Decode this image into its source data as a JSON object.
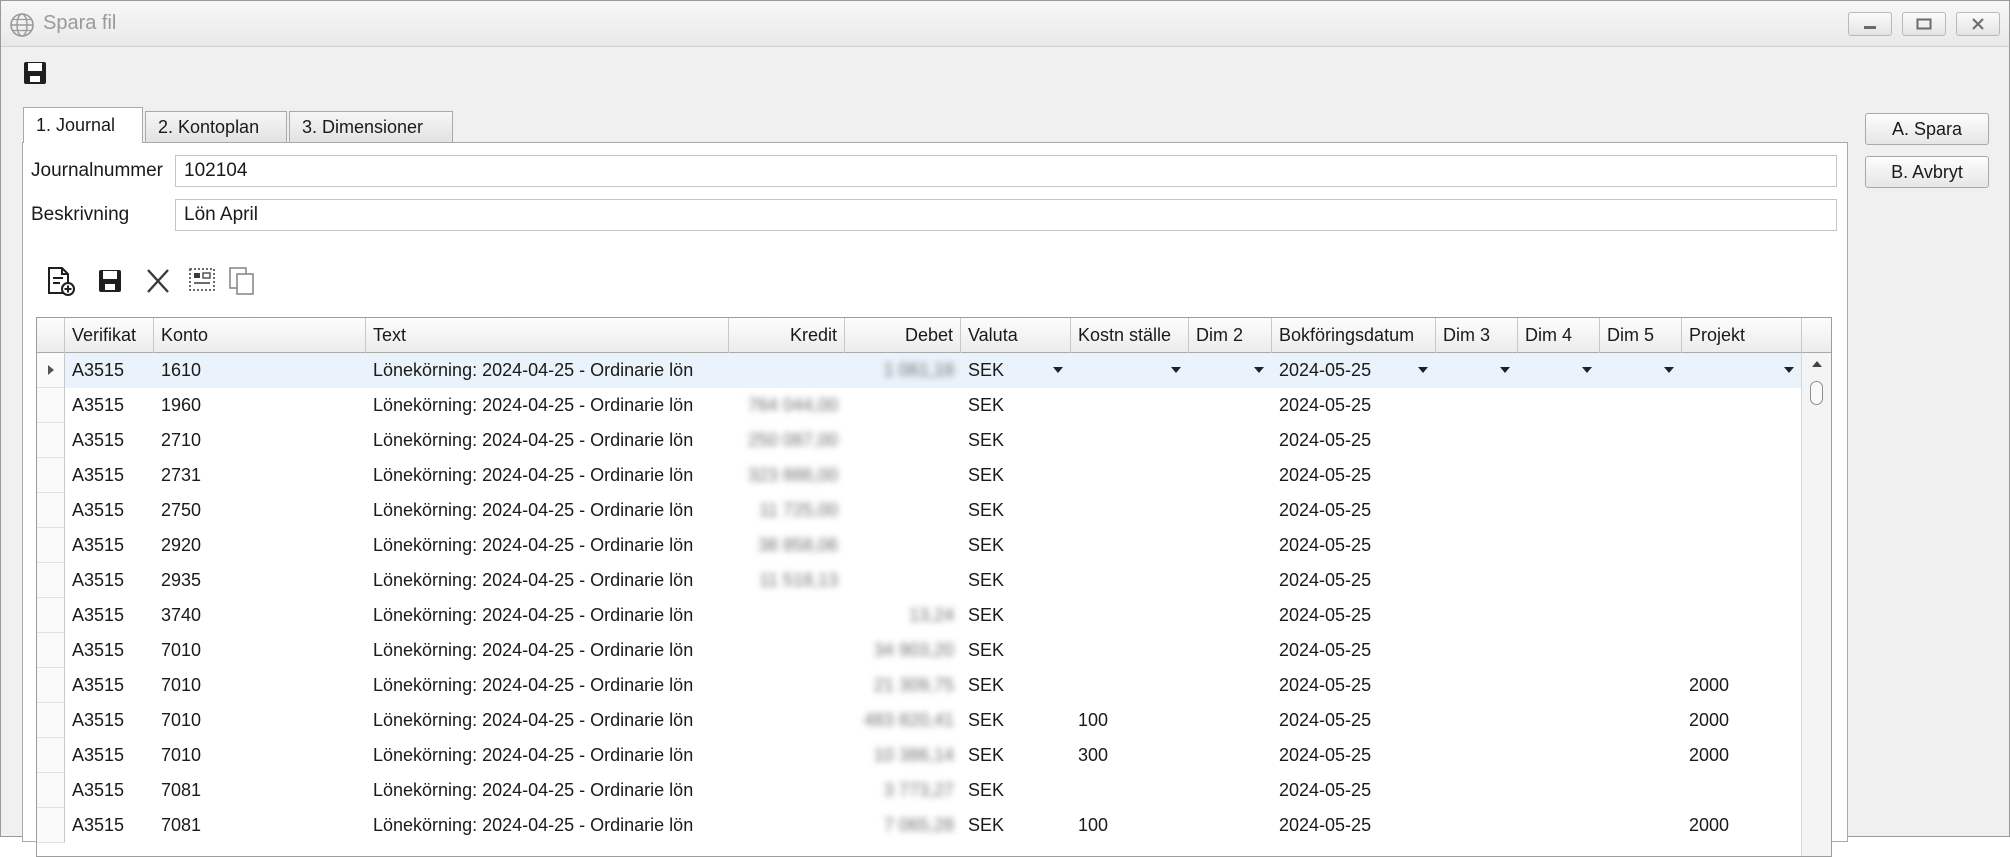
{
  "window": {
    "title": "Spara fil",
    "icon": "globe-icon",
    "controls": [
      "minimize-icon",
      "maximize-icon",
      "close-icon"
    ]
  },
  "toolbar": {
    "save_icon": "floppy-disk-icon"
  },
  "tabs": [
    {
      "label": "1. Journal",
      "active": true
    },
    {
      "label": "2. Kontoplan",
      "active": false
    },
    {
      "label": "3. Dimensioner",
      "active": false
    }
  ],
  "form": {
    "journalnummer_label": "Journalnummer",
    "journalnummer_value": "102104",
    "beskrivning_label": "Beskrivning",
    "beskrivning_value": "Lön April"
  },
  "grid_toolbar": [
    "new-document-icon",
    "save-icon",
    "delete-icon",
    "select-columns-icon",
    "copy-icon"
  ],
  "grid": {
    "columns": [
      "Verifikat",
      "Konto",
      "Text",
      "Kredit",
      "Debet",
      "Valuta",
      "Kostn ställe",
      "Dim 2",
      "Bokföringsdatum",
      "Dim 3",
      "Dim 4",
      "Dim 5",
      "Projekt"
    ],
    "rows": [
      {
        "verifikat": "A3515",
        "konto": "1610",
        "text": "Lönekörning: 2024-04-25 - Ordinarie lön",
        "kredit": "",
        "debet": "1 061,18",
        "valuta": "SEK",
        "kostnstalle": "",
        "dim2": "",
        "datum": "2024-05-25",
        "dim3": "",
        "dim4": "",
        "dim5": "",
        "projekt": ""
      },
      {
        "verifikat": "A3515",
        "konto": "1960",
        "text": "Lönekörning: 2024-04-25 - Ordinarie lön",
        "kredit": "764 044,00",
        "debet": "",
        "valuta": "SEK",
        "kostnstalle": "",
        "dim2": "",
        "datum": "2024-05-25",
        "dim3": "",
        "dim4": "",
        "dim5": "",
        "projekt": ""
      },
      {
        "verifikat": "A3515",
        "konto": "2710",
        "text": "Lönekörning: 2024-04-25 - Ordinarie lön",
        "kredit": "250 087,00",
        "debet": "",
        "valuta": "SEK",
        "kostnstalle": "",
        "dim2": "",
        "datum": "2024-05-25",
        "dim3": "",
        "dim4": "",
        "dim5": "",
        "projekt": ""
      },
      {
        "verifikat": "A3515",
        "konto": "2731",
        "text": "Lönekörning: 2024-04-25 - Ordinarie lön",
        "kredit": "323 886,00",
        "debet": "",
        "valuta": "SEK",
        "kostnstalle": "",
        "dim2": "",
        "datum": "2024-05-25",
        "dim3": "",
        "dim4": "",
        "dim5": "",
        "projekt": ""
      },
      {
        "verifikat": "A3515",
        "konto": "2750",
        "text": "Lönekörning: 2024-04-25 - Ordinarie lön",
        "kredit": "11 725,00",
        "debet": "",
        "valuta": "SEK",
        "kostnstalle": "",
        "dim2": "",
        "datum": "2024-05-25",
        "dim3": "",
        "dim4": "",
        "dim5": "",
        "projekt": ""
      },
      {
        "verifikat": "A3515",
        "konto": "2920",
        "text": "Lönekörning: 2024-04-25 - Ordinarie lön",
        "kredit": "38 858,06",
        "debet": "",
        "valuta": "SEK",
        "kostnstalle": "",
        "dim2": "",
        "datum": "2024-05-25",
        "dim3": "",
        "dim4": "",
        "dim5": "",
        "projekt": ""
      },
      {
        "verifikat": "A3515",
        "konto": "2935",
        "text": "Lönekörning: 2024-04-25 - Ordinarie lön",
        "kredit": "11 518,13",
        "debet": "",
        "valuta": "SEK",
        "kostnstalle": "",
        "dim2": "",
        "datum": "2024-05-25",
        "dim3": "",
        "dim4": "",
        "dim5": "",
        "projekt": ""
      },
      {
        "verifikat": "A3515",
        "konto": "3740",
        "text": "Lönekörning: 2024-04-25 - Ordinarie lön",
        "kredit": "",
        "debet": "13,24",
        "valuta": "SEK",
        "kostnstalle": "",
        "dim2": "",
        "datum": "2024-05-25",
        "dim3": "",
        "dim4": "",
        "dim5": "",
        "projekt": ""
      },
      {
        "verifikat": "A3515",
        "konto": "7010",
        "text": "Lönekörning: 2024-04-25 - Ordinarie lön",
        "kredit": "",
        "debet": "34 903,20",
        "valuta": "SEK",
        "kostnstalle": "",
        "dim2": "",
        "datum": "2024-05-25",
        "dim3": "",
        "dim4": "",
        "dim5": "",
        "projekt": ""
      },
      {
        "verifikat": "A3515",
        "konto": "7010",
        "text": "Lönekörning: 2024-04-25 - Ordinarie lön",
        "kredit": "",
        "debet": "21 309,75",
        "valuta": "SEK",
        "kostnstalle": "",
        "dim2": "",
        "datum": "2024-05-25",
        "dim3": "",
        "dim4": "",
        "dim5": "",
        "projekt": "2000"
      },
      {
        "verifikat": "A3515",
        "konto": "7010",
        "text": "Lönekörning: 2024-04-25 - Ordinarie lön",
        "kredit": "",
        "debet": "483 820,41",
        "valuta": "SEK",
        "kostnstalle": "100",
        "dim2": "",
        "datum": "2024-05-25",
        "dim3": "",
        "dim4": "",
        "dim5": "",
        "projekt": "2000"
      },
      {
        "verifikat": "A3515",
        "konto": "7010",
        "text": "Lönekörning: 2024-04-25 - Ordinarie lön",
        "kredit": "",
        "debet": "10 386,14",
        "valuta": "SEK",
        "kostnstalle": "300",
        "dim2": "",
        "datum": "2024-05-25",
        "dim3": "",
        "dim4": "",
        "dim5": "",
        "projekt": "2000"
      },
      {
        "verifikat": "A3515",
        "konto": "7081",
        "text": "Lönekörning: 2024-04-25 - Ordinarie lön",
        "kredit": "",
        "debet": "3 773,27",
        "valuta": "SEK",
        "kostnstalle": "",
        "dim2": "",
        "datum": "2024-05-25",
        "dim3": "",
        "dim4": "",
        "dim5": "",
        "projekt": ""
      },
      {
        "verifikat": "A3515",
        "konto": "7081",
        "text": "Lönekörning: 2024-04-25 - Ordinarie lön",
        "kredit": "",
        "debet": "7 065,28",
        "valuta": "SEK",
        "kostnstalle": "100",
        "dim2": "",
        "datum": "2024-05-25",
        "dim3": "",
        "dim4": "",
        "dim5": "",
        "projekt": "2000"
      }
    ]
  },
  "side_buttons": {
    "spara": "A. Spara",
    "avbryt": "B. Avbryt"
  }
}
